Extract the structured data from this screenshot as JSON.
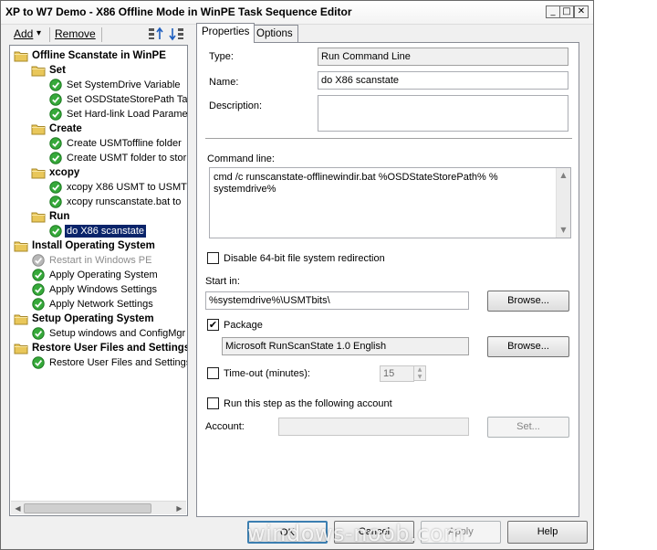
{
  "window": {
    "title": "XP to W7 Demo - X86 Offline Mode in WinPE Task Sequence Editor",
    "minimize": "_",
    "maximize": "□",
    "close": "✕"
  },
  "toolbar": {
    "add_label": "Add",
    "add_arrow": "▾",
    "remove_label": "Remove"
  },
  "tree": [
    {
      "label": "Offline Scanstate in WinPE",
      "type": "group",
      "level": 0
    },
    {
      "label": "Set",
      "type": "group",
      "level": 1
    },
    {
      "label": "Set SystemDrive Variable",
      "type": "step",
      "level": 2
    },
    {
      "label": "Set OSDStateStorePath Ta",
      "type": "step",
      "level": 2
    },
    {
      "label": "Set Hard-link Load Paramet",
      "type": "step",
      "level": 2
    },
    {
      "label": "Create",
      "type": "group",
      "level": 1
    },
    {
      "label": "Create USMToffline folder",
      "type": "step",
      "level": 2
    },
    {
      "label": "Create USMT folder to stor",
      "type": "step",
      "level": 2
    },
    {
      "label": "xcopy",
      "type": "group",
      "level": 1
    },
    {
      "label": "xcopy X86 USMT to USMTb",
      "type": "step",
      "level": 2
    },
    {
      "label": "xcopy runscanstate.bat to",
      "type": "step",
      "level": 2
    },
    {
      "label": "Run",
      "type": "group",
      "level": 1
    },
    {
      "label": "do X86 scanstate",
      "type": "step",
      "level": 2,
      "selected": true
    },
    {
      "label": "Install Operating System",
      "type": "group",
      "level": 0
    },
    {
      "label": "Restart in Windows PE",
      "type": "step",
      "level": 1,
      "disabled": true
    },
    {
      "label": "Apply Operating System",
      "type": "step",
      "level": 1
    },
    {
      "label": "Apply Windows Settings",
      "type": "step",
      "level": 1
    },
    {
      "label": "Apply Network Settings",
      "type": "step",
      "level": 1
    },
    {
      "label": "Setup Operating System",
      "type": "group",
      "level": 0
    },
    {
      "label": "Setup windows and ConfigMgr",
      "type": "step",
      "level": 1
    },
    {
      "label": "Restore User Files and Settings",
      "type": "group",
      "level": 0
    },
    {
      "label": "Restore User Files and Settings",
      "type": "step",
      "level": 1
    }
  ],
  "tabs": {
    "properties": "Properties",
    "options": "Options"
  },
  "props": {
    "type_label": "Type:",
    "type_value": "Run Command Line",
    "name_label": "Name:",
    "name_value": "do X86 scanstate",
    "description_label": "Description:",
    "description_value": "",
    "command_label": "Command line:",
    "command_value": "cmd /c runscanstate-offlinewindir.bat %OSDStateStorePath% %\nsystemdrive%",
    "disable64_label": "Disable 64-bit file system redirection",
    "disable64_checked": false,
    "startin_label": "Start in:",
    "startin_value": "%systemdrive%\\USMTbits\\",
    "browse_label": "Browse...",
    "package_label": "Package",
    "package_checked": true,
    "package_value": "Microsoft RunScanState 1.0 English",
    "browse2_label": "Browse...",
    "timeout_label": "Time-out (minutes):",
    "timeout_checked": false,
    "timeout_value": "15",
    "runas_label": "Run this step as the following account",
    "runas_checked": false,
    "account_label": "Account:",
    "account_value": "",
    "set_label": "Set..."
  },
  "footer": {
    "ok": "OK",
    "cancel": "Cancel",
    "apply": "Apply",
    "help": "Help"
  },
  "watermark": "windows-noob.com"
}
